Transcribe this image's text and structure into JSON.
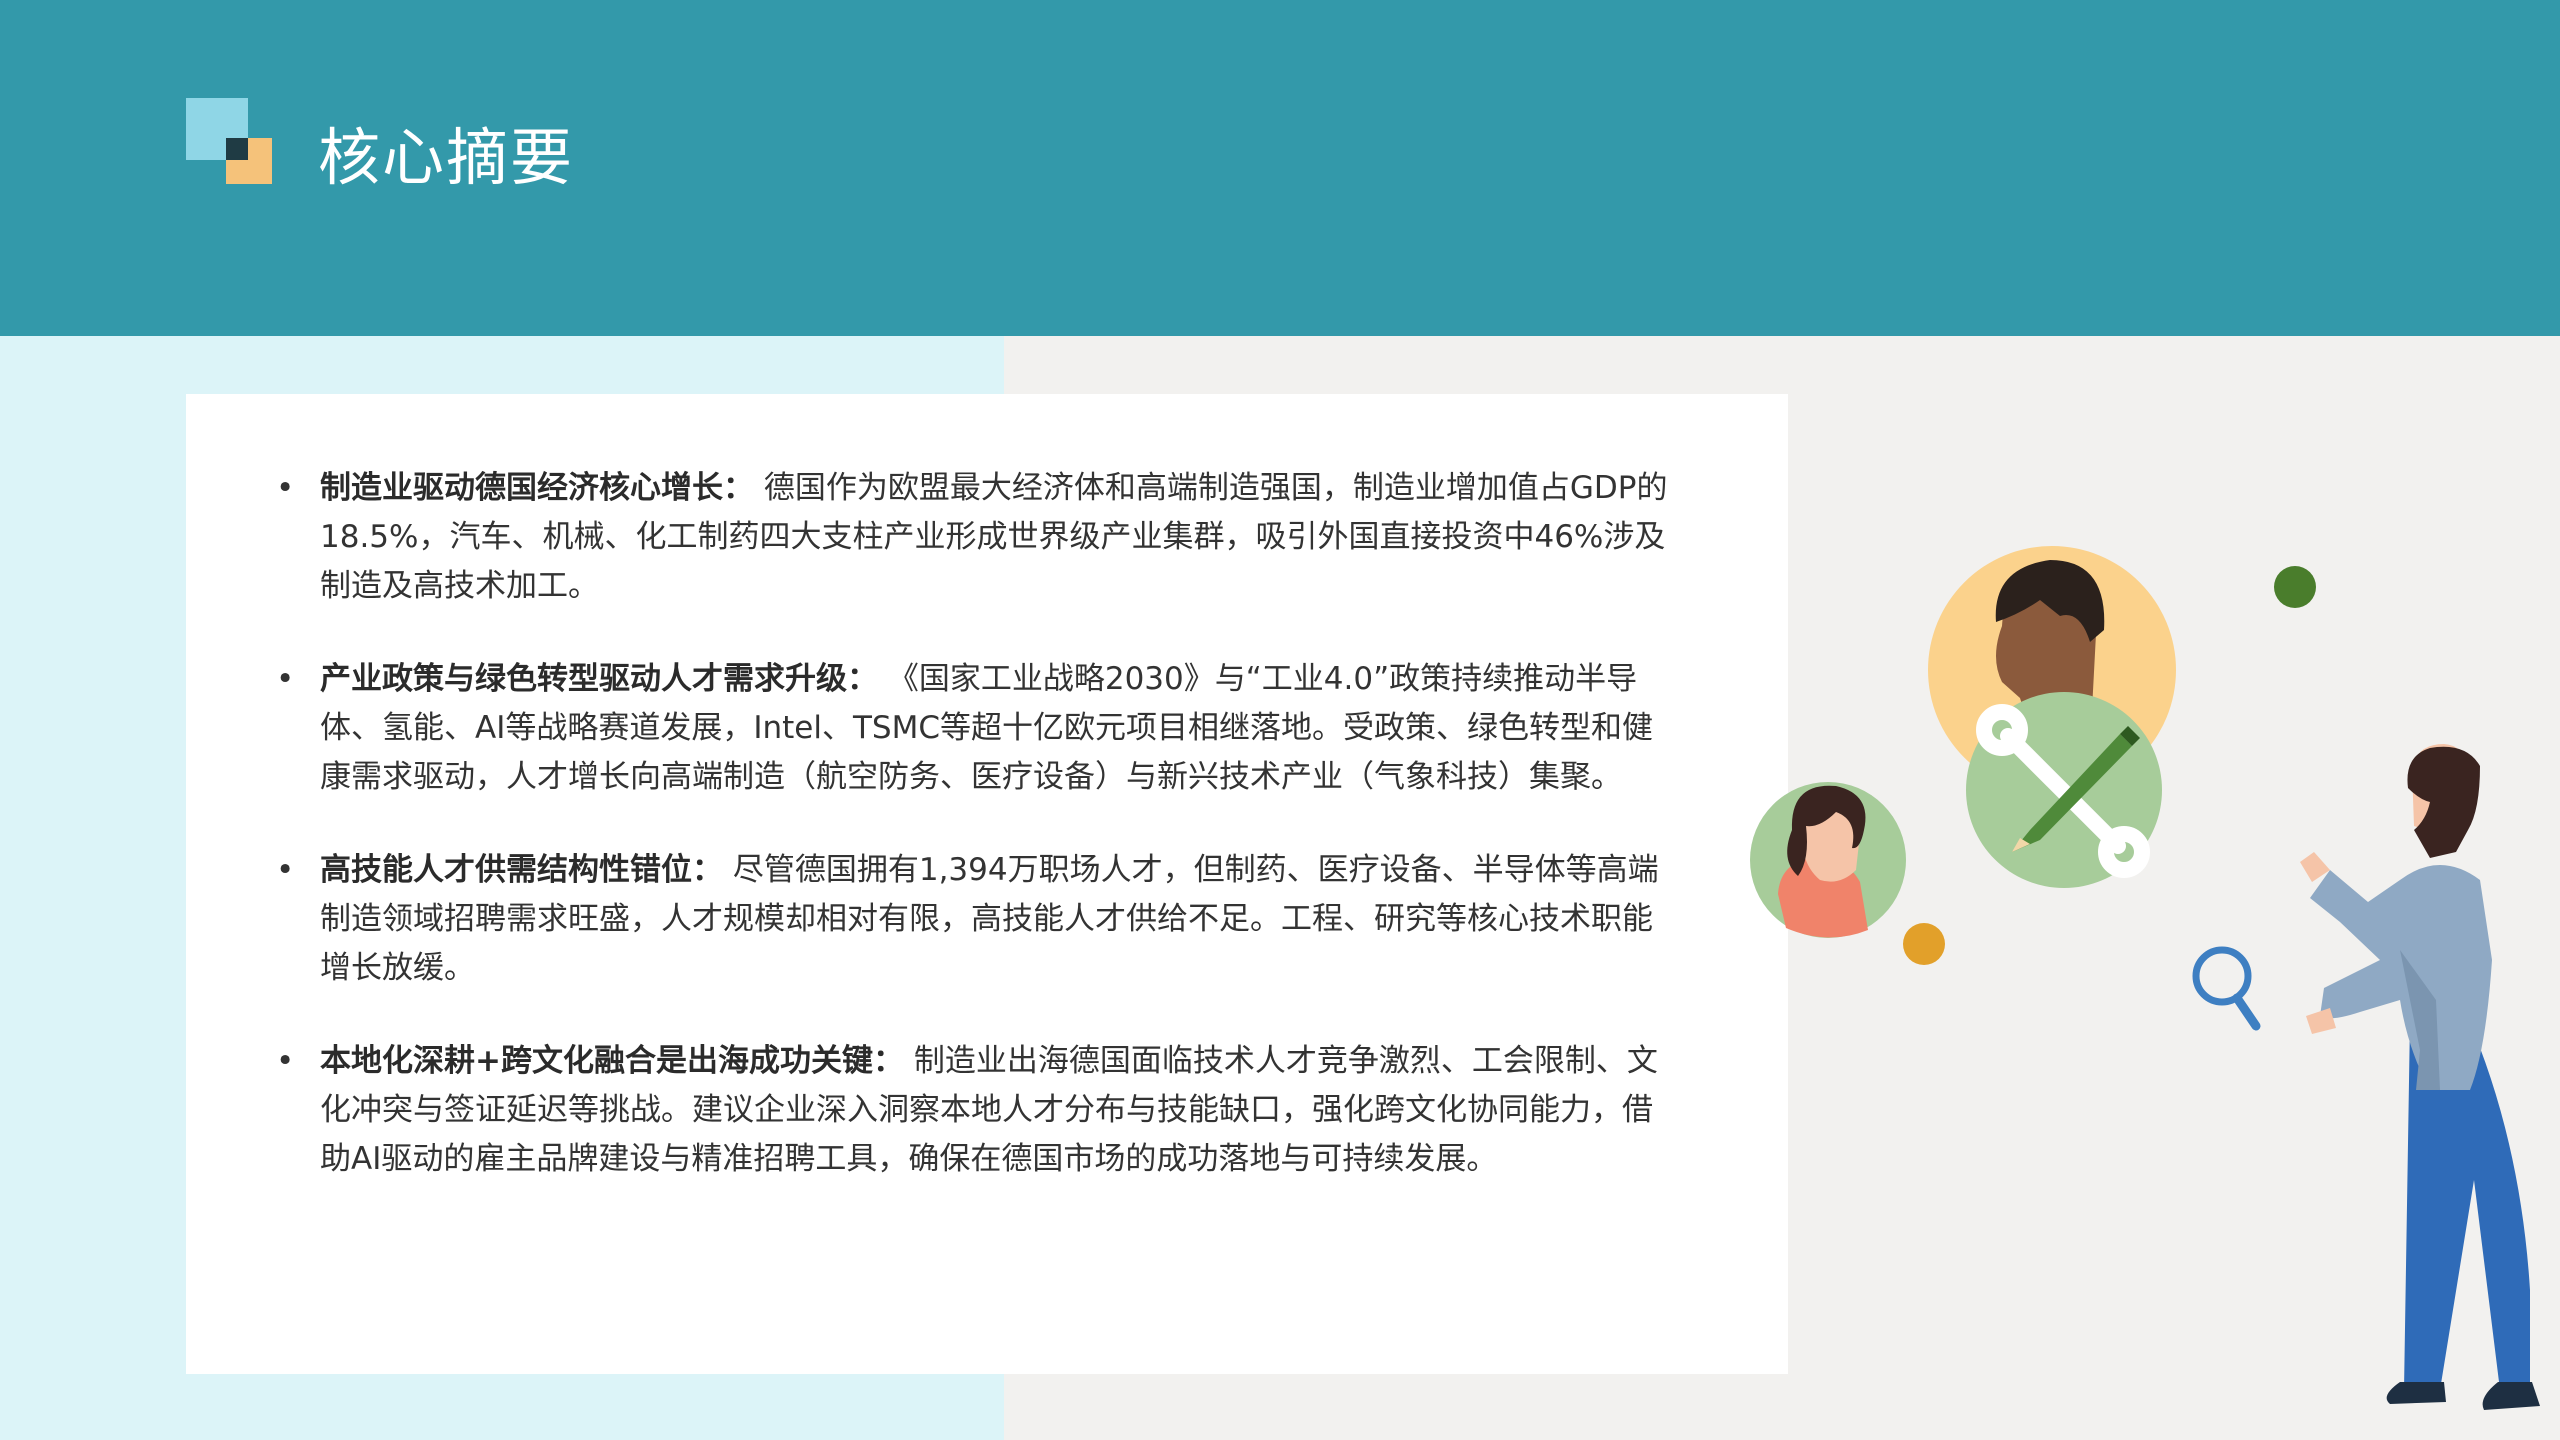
{
  "header": {
    "title": "核心摘要"
  },
  "colors": {
    "header_bg": "#3399aa",
    "left_band": "#dcf4f8",
    "page_bg": "#f2f1ef",
    "card_bg": "#ffffff"
  },
  "summary": {
    "items": [
      {
        "heading": "制造业驱动德国经济核心增长：",
        "body": " 德国作为欧盟最大经济体和高端制造强国，制造业增加值占GDP的18.5%，汽车、机械、化工制药四大支柱产业形成世界级产业集群，吸引外国直接投资中46%涉及制造及高技术加工。"
      },
      {
        "heading": "产业政策与绿色转型驱动人才需求升级：",
        "body": " 《国家工业战略2030》与“工业4.0”政策持续推动半导体、氢能、AI等战略赛道发展，Intel、TSMC等超十亿欧元项目相继落地。受政策、绿色转型和健康需求驱动，人才增长向高端制造（航空防务、医疗设备）与新兴技术产业（气象科技）集聚。"
      },
      {
        "heading": "高技能人才供需结构性错位：",
        "body": " 尽管德国拥有1,394万职场人才，但制药、医疗设备、半导体等高端制造领域招聘需求旺盛，人才规模却相对有限，高技能人才供给不足。工程、研究等核心技术职能增长放缓。"
      },
      {
        "heading": "本地化深耕+跨文化融合是出海成功关键：",
        "body": " 制造业出海德国面临技术人才竞争激烈、工会限制、文化冲突与签证延迟等挑战。建议企业深入洞察本地人才分布与技能缺口，强化跨文化协同能力，借助AI驱动的雇主品牌建设与精准招聘工具，确保在德国市场的成功落地与可持续发展。"
      }
    ]
  },
  "illustration": {
    "icons": [
      "man-avatar-icon",
      "woman-avatar-icon",
      "wrench-pencil-icon",
      "magnifier-icon",
      "person-figure-icon"
    ]
  }
}
